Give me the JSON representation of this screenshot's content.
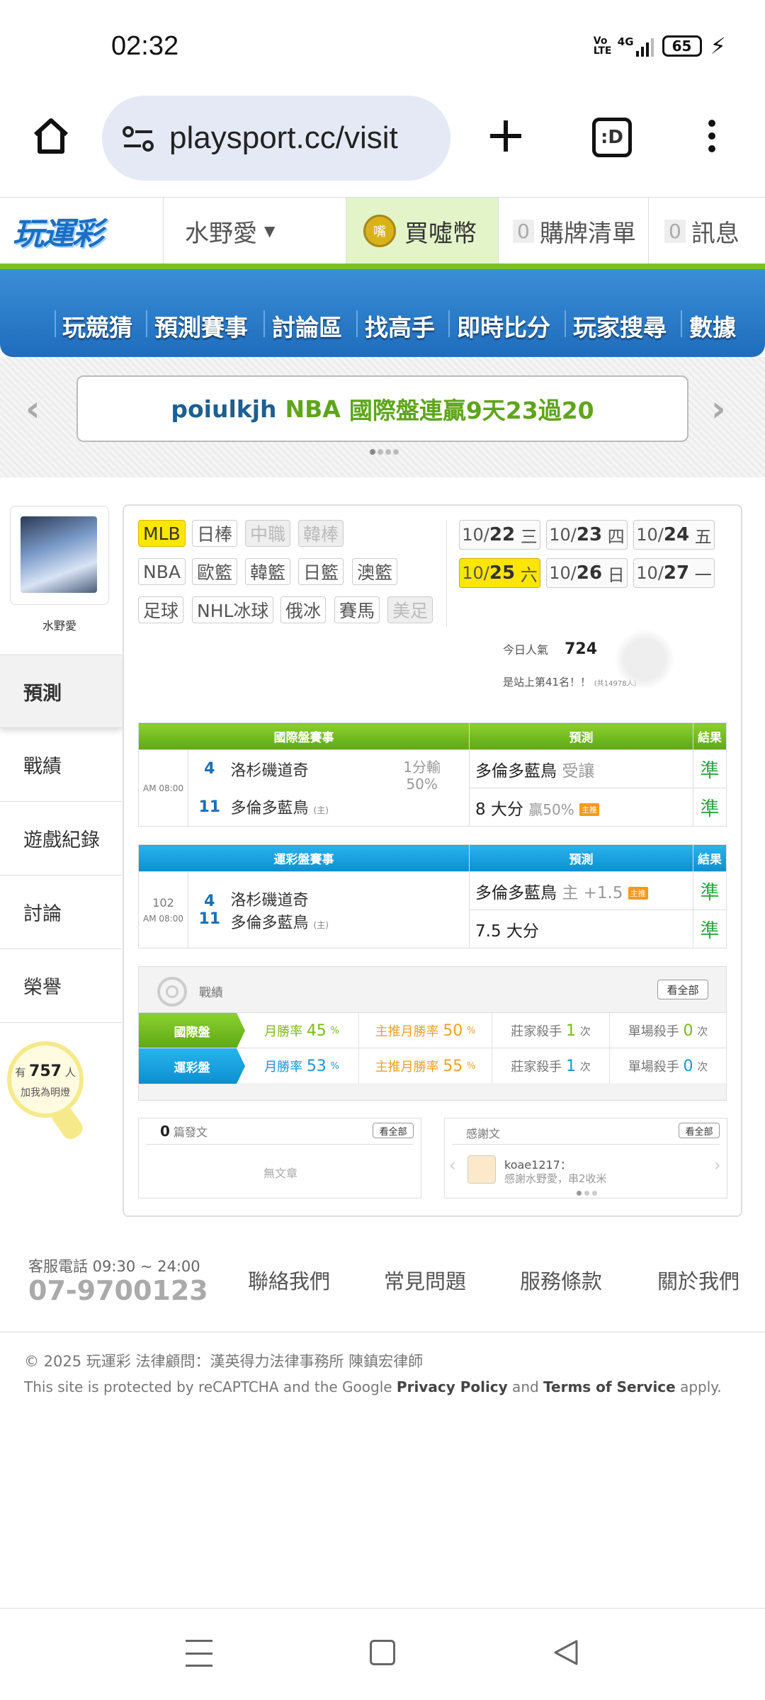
{
  "status_bar": {
    "time": "02:32",
    "volte": "Vo LTE",
    "network": "4G",
    "battery": "65"
  },
  "browser": {
    "url": "playsport.cc/visit",
    "tab_button": ":D"
  },
  "site_header": {
    "logo": "玩運彩",
    "username": "水野愛",
    "coin_icon": "嘴",
    "buy_coins": "買噓幣",
    "cart_count": "0",
    "cart_label": "購牌清單",
    "msg_count": "0",
    "msg_label": "訊息"
  },
  "nav": {
    "items": [
      "玩競猜",
      "預測賽事",
      "討論區",
      "找高手",
      "即時比分",
      "玩家搜尋",
      "數據"
    ]
  },
  "banner": {
    "user": "poiulkjh",
    "league": "NBA",
    "text": "國際盤連贏9天23過20"
  },
  "profile": {
    "name": "水野愛",
    "menu": [
      "預測",
      "戰績",
      "遊戲紀錄",
      "討論",
      "榮譽"
    ],
    "fans_prefix": "有",
    "fans_count": "757",
    "fans_suffix": "人",
    "fans_cta": "加我為明燈"
  },
  "leagues": {
    "row1": [
      "MLB",
      "日棒",
      "中職",
      "韓棒"
    ],
    "row2": [
      "NBA",
      "歐籃",
      "韓籃",
      "日籃",
      "澳籃"
    ],
    "row3": [
      "足球",
      "NHL冰球",
      "俄冰",
      "賽馬",
      "美足"
    ]
  },
  "dates": {
    "row1": [
      {
        "m": "10/",
        "d": "22",
        "w": "三"
      },
      {
        "m": "10/",
        "d": "23",
        "w": "四"
      },
      {
        "m": "10/",
        "d": "24",
        "w": "五"
      }
    ],
    "row2": [
      {
        "m": "10/",
        "d": "25",
        "w": "六"
      },
      {
        "m": "10/",
        "d": "26",
        "w": "日"
      },
      {
        "m": "10/",
        "d": "27",
        "w": "一"
      }
    ]
  },
  "popularity": {
    "label": "今日人氣",
    "value": "724",
    "rank_text": "是站上第41名！！",
    "rank_total": "(共14978人)"
  },
  "intl_table": {
    "h_game": "國際盤賽事",
    "h_pred": "預測",
    "h_result": "結果",
    "time": "AM 08:00",
    "away_num": "4",
    "away_team": "洛杉磯道奇",
    "home_num": "11",
    "home_team": "多倫多藍鳥",
    "home_tag": "(主)",
    "line1": "1分輸",
    "line2": "50%",
    "pred1": "多倫多藍鳥",
    "pred1_note": "受讓",
    "pred2": "8 大分",
    "pred2_note": "贏50%",
    "result1": "準",
    "result2": "準"
  },
  "lottery_table": {
    "h_game": "運彩盤賽事",
    "h_pred": "預測",
    "h_result": "結果",
    "game_no": "102",
    "time": "AM 08:00",
    "away_num": "4",
    "away_team": "洛杉磯道奇",
    "home_num": "11",
    "home_team": "多倫多藍鳥",
    "home_tag": "(主)",
    "pred1": "多倫多藍鳥",
    "pred1_note": "主 +1.5",
    "pred2": "7.5 大分",
    "result1": "準",
    "result2": "準"
  },
  "record": {
    "title": "戰績",
    "see_all": "看全部",
    "rows": [
      {
        "label": "國際盤",
        "win_label": "月勝率",
        "win": "45",
        "main_label": "主推月勝率",
        "main": "50",
        "pct": "%",
        "killer_label": "莊家殺手",
        "killer": "1",
        "single_label": "單場殺手",
        "single": "0",
        "unit": "次"
      },
      {
        "label": "運彩盤",
        "win_label": "月勝率",
        "win": "53",
        "main_label": "主推月勝率",
        "main": "55",
        "pct": "%",
        "killer_label": "莊家殺手",
        "killer": "1",
        "single_label": "單場殺手",
        "single": "0",
        "unit": "次"
      }
    ]
  },
  "articles": {
    "count": "0",
    "label": "篇發文",
    "see_all": "看全部",
    "empty": "無文章"
  },
  "thanks": {
    "title": "感謝文",
    "see_all": "看全部",
    "user": "koae1217：",
    "text": "感謝水野愛，串2收米"
  },
  "footer": {
    "phone_label": "客服電話 09:30 ~ 24:00",
    "phone": "07-9700123",
    "links": [
      "聯絡我們",
      "常見問題",
      "服務條款",
      "關於我們"
    ],
    "copyright": "© 2025 玩運彩 法律顧問：漢英得力法律事務所 陳鎮宏律師",
    "recaptcha_pre": "This site is protected by reCAPTCHA and the Google ",
    "privacy": "Privacy Policy",
    "and": " and ",
    "terms": "Terms of Service",
    "apply": " apply."
  },
  "colors": {
    "green": "#7cc21f",
    "blue": "#1f6cbd",
    "yellow": "#ffe600",
    "accent_orange": "#f39a1d"
  }
}
